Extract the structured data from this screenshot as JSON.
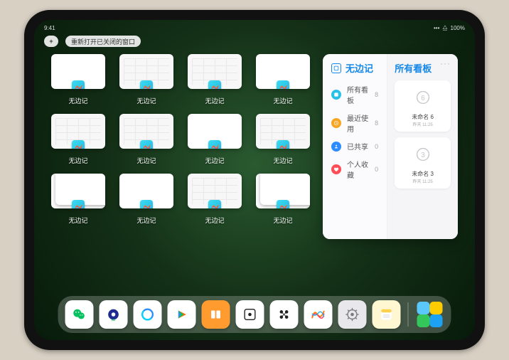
{
  "status": {
    "time": "9:41",
    "signal": "•••",
    "wifi": "⧋",
    "battery": "100%"
  },
  "controls": {
    "add_label": "+",
    "tip_label": "重新打开已关闭的窗口"
  },
  "windows": [
    {
      "label": "无边记",
      "style": "blank"
    },
    {
      "label": "无边记",
      "style": "grid"
    },
    {
      "label": "无边记",
      "style": "grid"
    },
    {
      "label": "无边记",
      "style": "blank"
    },
    {
      "label": "无边记",
      "style": "grid"
    },
    {
      "label": "无边记",
      "style": "grid"
    },
    {
      "label": "无边记",
      "style": "blank"
    },
    {
      "label": "无边记",
      "style": "grid"
    },
    {
      "label": "无边记",
      "style": "stack"
    },
    {
      "label": "无边记",
      "style": "blank"
    },
    {
      "label": "无边记",
      "style": "grid"
    },
    {
      "label": "无边记",
      "style": "stack"
    }
  ],
  "panel": {
    "left_title": "无边记",
    "categories": [
      {
        "name": "所有看板",
        "count": 8,
        "color": "#29c0e8"
      },
      {
        "name": "最近使用",
        "count": 8,
        "color": "#f6a623"
      },
      {
        "name": "已共享",
        "count": 0,
        "color": "#2d8cff"
      },
      {
        "name": "个人收藏",
        "count": 0,
        "color": "#ff4d55"
      }
    ],
    "right_title": "所有看板",
    "more": "···",
    "cards": [
      {
        "name": "未命名 6",
        "time": "昨天 11:25",
        "digit": "6"
      },
      {
        "name": "未命名 3",
        "time": "昨天 11:25",
        "digit": "3"
      }
    ]
  },
  "dock": {
    "items": [
      {
        "name": "wechat",
        "bg": "#ffffff"
      },
      {
        "name": "iqiyi",
        "bg": "#ffffff"
      },
      {
        "name": "qqbrowser",
        "bg": "#ffffff"
      },
      {
        "name": "tencent-video",
        "bg": "#ffffff"
      },
      {
        "name": "books",
        "bg": "#ff9b2f"
      },
      {
        "name": "game",
        "bg": "#ffffff"
      },
      {
        "name": "misc",
        "bg": "#ffffff"
      },
      {
        "name": "freeform",
        "bg": "#ffffff"
      },
      {
        "name": "settings",
        "bg": "#e8e8ec"
      },
      {
        "name": "notes",
        "bg": "#fff6d2"
      }
    ]
  }
}
